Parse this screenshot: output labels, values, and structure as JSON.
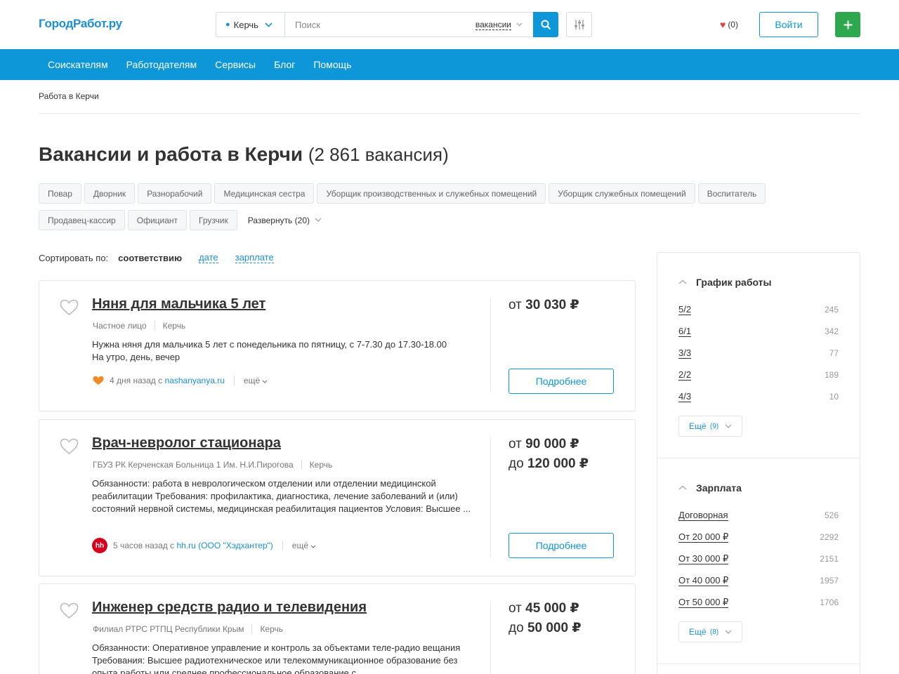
{
  "header": {
    "logo": "ГородРабот.ру",
    "city": "Керчь",
    "search_placeholder": "Поиск",
    "search_scope": "вакансии",
    "favorites": "(0)",
    "login": "Войти"
  },
  "nav": [
    "Соискателям",
    "Работодателям",
    "Сервисы",
    "Блог",
    "Помощь"
  ],
  "breadcrumb": "Работа в Керчи",
  "page": {
    "title": "Вакансии и работа в Керчи",
    "count": "(2 861 вакансия)"
  },
  "tags_row1": [
    "Повар",
    "Дворник",
    "Разнорабочий",
    "Медицинская сестра",
    "Уборщик производственных и служебных помещений",
    "Уборщик служебных помещений",
    "Воспитатель"
  ],
  "tags_row2": [
    "Продавец-кассир",
    "Официант",
    "Грузчик"
  ],
  "tags_expand": "Развернуть (20)",
  "sort": {
    "label": "Сортировать по:",
    "active": "соответствию",
    "options": [
      "дате",
      "зарплате"
    ]
  },
  "vacancies": [
    {
      "title": "Няня для мальчика 5 лет",
      "employer": "Частное лицо",
      "city": "Керчь",
      "desc": [
        "Нужна няня для мальчика 5 лет с понедельника по пятницу, с 7-7.30 до 17.30-18.00",
        "На утро, день, вечер"
      ],
      "posted": "4 дня назад с",
      "source": "nashanyanya.ru",
      "more": "ещё",
      "salary_from_label": "от",
      "salary_from": "30 030 ₽",
      "details": "Подробнее"
    },
    {
      "title": "Врач-невролог стационара",
      "employer": "ГБУЗ РК Керченская Больница 1 Им. Н.И.Пирогова",
      "city": "Керчь",
      "desc": [
        "Обязанности: работа в неврологическом отделении или отделении медицинской реабилитации Требования: профилактика, диагностика, лечение заболеваний и (или) состояний нервной системы, медицинская реабилитация пациентов Условия: Высшее ..."
      ],
      "posted": "5 часов назад с",
      "source": "hh.ru (ООО \"Хэдхантер\")",
      "source_icon": "hh",
      "more": "ещё",
      "salary_from_label": "от",
      "salary_from": "90 000 ₽",
      "salary_to_label": "до",
      "salary_to": "120 000 ₽",
      "details": "Подробнее"
    },
    {
      "title": "Инженер средств радио и телевидения",
      "employer": "Филиал РТРС РТПЦ Республики Крым",
      "city": "Керчь",
      "desc": [
        "Обязанности: Оперативное управление и контроль за объектами теле-радио вещания Требования: Высшее радиотехническое или телекоммуникационное образование без опыта работы или среднее профессиональное образование с"
      ],
      "salary_from_label": "от",
      "salary_from": "45 000 ₽",
      "salary_to_label": "до",
      "salary_to": "50 000 ₽"
    }
  ],
  "sidebar": {
    "schedule": {
      "title": "График работы",
      "items": [
        {
          "label": "5/2",
          "count": "245"
        },
        {
          "label": "6/1",
          "count": "342"
        },
        {
          "label": "3/3",
          "count": "77"
        },
        {
          "label": "2/2",
          "count": "189"
        },
        {
          "label": "4/3",
          "count": "10"
        }
      ],
      "more": "Ещё",
      "more_count": "(9)"
    },
    "salary": {
      "title": "Зарплата",
      "items": [
        {
          "label": "Договорная",
          "count": "526"
        },
        {
          "label": "От 20 000 ₽",
          "count": "2292"
        },
        {
          "label": "От 30 000 ₽",
          "count": "2151"
        },
        {
          "label": "От 40 000 ₽",
          "count": "1957"
        },
        {
          "label": "От 50 000 ₽",
          "count": "1706"
        }
      ],
      "more": "Ещё",
      "more_count": "(8)"
    }
  },
  "colors": {
    "brand_blue": "#0d96d8",
    "add_green": "#2ea84f",
    "heart_red": "#e04040",
    "hh_red": "#d6001c",
    "nashanyanya_orange": "#f08a24"
  }
}
